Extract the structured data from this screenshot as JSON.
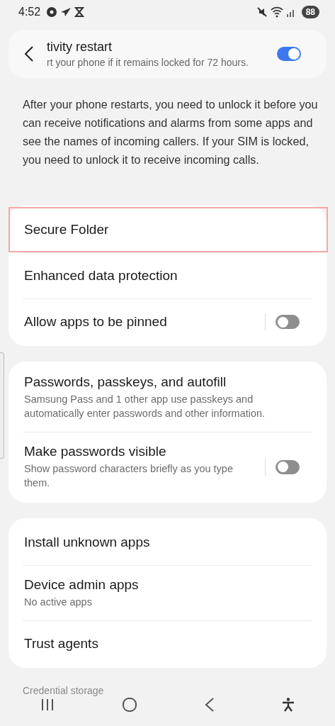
{
  "status_bar": {
    "time": "4:52",
    "battery": "88"
  },
  "header": {
    "title": "tivity restart",
    "subtitle": "rt your phone if it remains locked for 72 hours.",
    "on": true
  },
  "description": "After your phone restarts, you need to unlock it before you can receive notifications and alarms from some apps and see the names of incoming callers. If your SIM is locked, you need to unlock it to receive incoming calls.",
  "cards": [
    {
      "rows": [
        {
          "kind": "plain",
          "title": "Secure Folder",
          "highlighted": true
        },
        {
          "kind": "plain",
          "title": "Enhanced data protection",
          "highlighted": false
        },
        {
          "kind": "switch",
          "title": "Allow apps to be pinned",
          "on": false,
          "highlighted": false
        }
      ]
    },
    {
      "rows": [
        {
          "kind": "plain",
          "title": "Passwords, passkeys, and autofill",
          "subtitle": "Samsung Pass and 1 other app use passkeys and automatically enter passwords and other information.",
          "highlighted": false
        },
        {
          "kind": "switch",
          "title": "Make passwords visible",
          "subtitle": "Show password characters briefly as you type them.",
          "on": false,
          "highlighted": false
        }
      ]
    },
    {
      "rows": [
        {
          "kind": "plain",
          "title": "Install unknown apps",
          "highlighted": false
        },
        {
          "kind": "plain",
          "title": "Device admin apps",
          "subtitle": "No active apps",
          "highlighted": false
        },
        {
          "kind": "plain",
          "title": "Trust agents",
          "highlighted": false
        }
      ]
    }
  ],
  "next_section": "Credential storage"
}
